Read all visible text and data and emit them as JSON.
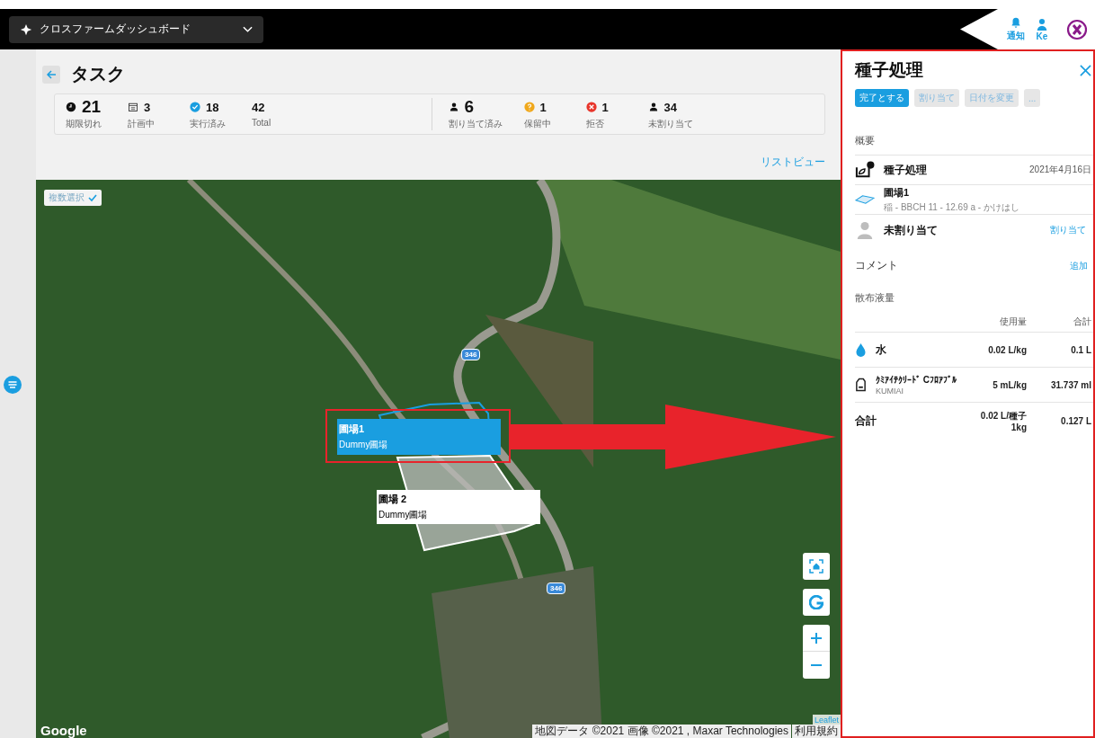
{
  "top_bar": {
    "app_title": "クロスファームダッシュボード",
    "notifications_label": "通知",
    "user_label": "Ke"
  },
  "page": {
    "title": "タスク",
    "view_link": "リストビュー"
  },
  "task_stats": [
    {
      "kind": "overdue",
      "value": "21",
      "label": "期限切れ",
      "large": true
    },
    {
      "kind": "planned",
      "value": "3",
      "label": "計画中",
      "large": false
    },
    {
      "kind": "done",
      "value": "18",
      "label": "実行済み",
      "large": false
    },
    {
      "kind": "total",
      "value": "42",
      "label": "Total",
      "large": false
    }
  ],
  "assign_stats": [
    {
      "kind": "assigned",
      "value": "6",
      "label": "割り当て済み",
      "large": true
    },
    {
      "kind": "pending",
      "value": "1",
      "label": "保留中",
      "large": false
    },
    {
      "kind": "rejected",
      "value": "1",
      "label": "拒否",
      "large": false
    },
    {
      "kind": "unassigned",
      "value": "34",
      "label": "未割り当て",
      "large": false
    }
  ],
  "map": {
    "multi_select": {
      "label": "複数選択",
      "checked": true
    },
    "fields": [
      {
        "name": "圃場1",
        "subtitle": "Dummy圃場",
        "selected": true
      },
      {
        "name": "圃場 2",
        "subtitle": "Dummy圃場",
        "selected": false
      }
    ],
    "road_markers": [
      "346",
      "346"
    ],
    "controls": [
      {
        "kind": "home"
      },
      {
        "kind": "google"
      },
      {
        "kind": "zoom_in"
      },
      {
        "kind": "zoom_out"
      }
    ],
    "logo": "Google",
    "leaflet_link": "Leaflet",
    "attribution": "地図データ ©2021 画像 ©2021 , Maxar Technologies",
    "terms_link": "利用規約"
  },
  "detail": {
    "title": "種子処理",
    "actions": [
      {
        "label": "完了とする",
        "kind": "primary"
      },
      {
        "label": "割り当て",
        "kind": "secondary"
      },
      {
        "label": "日付を変更",
        "kind": "secondary"
      },
      {
        "label": "...",
        "kind": "secondary"
      }
    ],
    "overview_heading": "概要",
    "task": {
      "name": "種子処理",
      "date": "2021年4月16日"
    },
    "field": {
      "name": "圃場1",
      "detail": "稲 - BBCH 11 - 12.69 a - かけはし"
    },
    "assignee": {
      "name": "未割り当て",
      "action": "割り当て"
    },
    "comments": {
      "heading": "コメント",
      "action": "追加"
    },
    "application": {
      "heading": "散布液量",
      "columns": [
        "使用量",
        "合計"
      ],
      "rows": [
        {
          "kind": "water",
          "name": "水",
          "rate": "0.02 L/kg",
          "total": "0.1 L"
        },
        {
          "kind": "product",
          "name": "ｸﾐｱｲﾃｸﾘｰﾄﾞ Cﾌﾛｱﾌﾞﾙ",
          "maker": "KUMIAI",
          "rate": "5 mL/kg",
          "total": "31.737 ml"
        }
      ],
      "total": {
        "label": "合計",
        "rate_lines": [
          "0.02 L/種子",
          "1kg"
        ],
        "total": "0.127 L"
      }
    }
  }
}
